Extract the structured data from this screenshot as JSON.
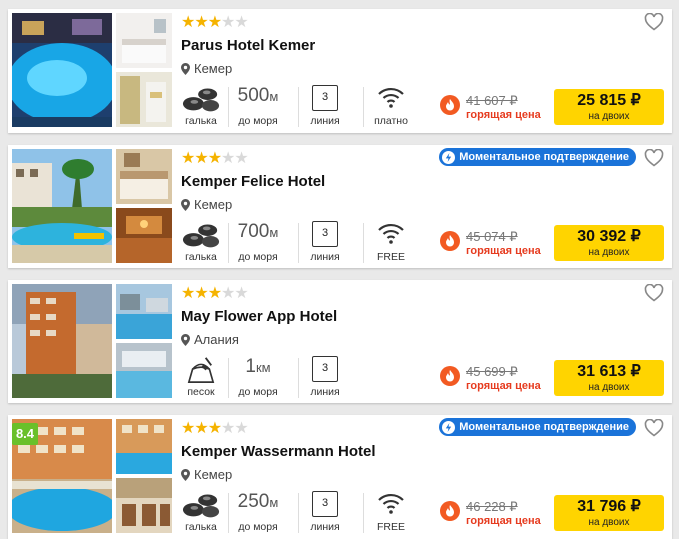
{
  "colors": {
    "accent_yellow": "#ffd400",
    "hot_red": "#e63b1f",
    "star_gold": "#f5b300",
    "badge_blue": "#1a73d9",
    "score_green": "#6ac02a"
  },
  "hotels": [
    {
      "stars": 3,
      "star_max": 5,
      "name": "Parus Hotel Kemer",
      "location": "Кемер",
      "beach_label": "галька",
      "distance_value": "500",
      "distance_unit": "м",
      "distance_label": "до моря",
      "line_value": "3",
      "line_label": "линия",
      "wifi_label": "платно",
      "old_price": "41 607 ₽",
      "hot_label": "горящая цена",
      "price": "25 815 ₽",
      "price_note": "на двоих"
    },
    {
      "stars": 3,
      "star_max": 5,
      "badge": "Моментальное подтверждение",
      "name": "Kemper Felice Hotel",
      "location": "Кемер",
      "beach_label": "галька",
      "distance_value": "700",
      "distance_unit": "м",
      "distance_label": "до моря",
      "line_value": "3",
      "line_label": "линия",
      "wifi_label": "FREE",
      "old_price": "45 074 ₽",
      "hot_label": "горящая цена",
      "price": "30 392 ₽",
      "price_note": "на двоих"
    },
    {
      "stars": 3,
      "star_max": 5,
      "name": "May Flower App Hotel",
      "location": "Алания",
      "beach_label": "песок",
      "distance_value": "1",
      "distance_unit": "км",
      "distance_label": "до моря",
      "line_value": "3",
      "line_label": "линия",
      "old_price": "45 699 ₽",
      "hot_label": "горящая цена",
      "price": "31 613 ₽",
      "price_note": "на двоих"
    },
    {
      "score": "8.4",
      "stars": 3,
      "star_max": 5,
      "badge": "Моментальное подтверждение",
      "name": "Kemper Wassermann Hotel",
      "location": "Кемер",
      "beach_label": "галька",
      "distance_value": "250",
      "distance_unit": "м",
      "distance_label": "до моря",
      "line_value": "3",
      "line_label": "линия",
      "wifi_label": "FREE",
      "old_price": "46 228 ₽",
      "hot_label": "горящая цена",
      "price": "31 796 ₽",
      "price_note": "на двоих"
    }
  ]
}
